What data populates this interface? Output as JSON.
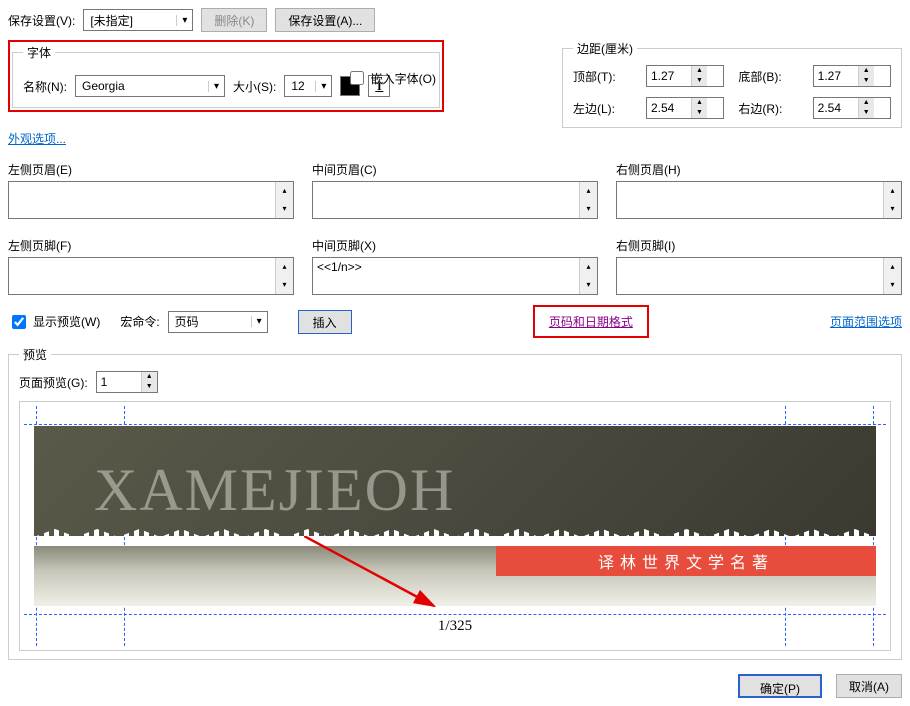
{
  "save_settings": {
    "label": "保存设置(V):",
    "value": "[未指定]",
    "delete_btn": "删除(K)",
    "save_btn": "保存设置(A)..."
  },
  "font": {
    "legend": "字体",
    "name_label": "名称(N):",
    "name_value": "Georgia",
    "size_label": "大小(S):",
    "size_value": "12",
    "embed_label": "嵌入字体(O)"
  },
  "margins": {
    "legend": "边距(厘米)",
    "top_label": "顶部(T):",
    "top_value": "1.27",
    "bottom_label": "底部(B):",
    "bottom_value": "1.27",
    "left_label": "左边(L):",
    "left_value": "2.54",
    "right_label": "右边(R):",
    "right_value": "2.54"
  },
  "appearance_link": "外观选项...",
  "headers": {
    "left_header": "左侧页眉(E)",
    "center_header": "中间页眉(C)",
    "right_header": "右侧页眉(H)",
    "left_footer": "左侧页脚(F)",
    "center_footer": "中间页脚(X)",
    "right_footer": "右侧页脚(I)",
    "center_footer_value": "<<1/n>>"
  },
  "controls": {
    "show_preview": "显示预览(W)",
    "macro_label": "宏命令:",
    "macro_value": "页码",
    "insert_btn": "插入",
    "page_date_format": "页码和日期格式",
    "page_range_options": "页面范围选项"
  },
  "preview": {
    "legend": "预览",
    "page_preview_label": "页面预览(G):",
    "page_value": "1",
    "header_text": "XAMEJIEOH",
    "banner_text": "译林世界文学名著",
    "page_number": "1/325"
  },
  "buttons": {
    "ok": "确定(P)",
    "cancel": "取消(A)"
  }
}
